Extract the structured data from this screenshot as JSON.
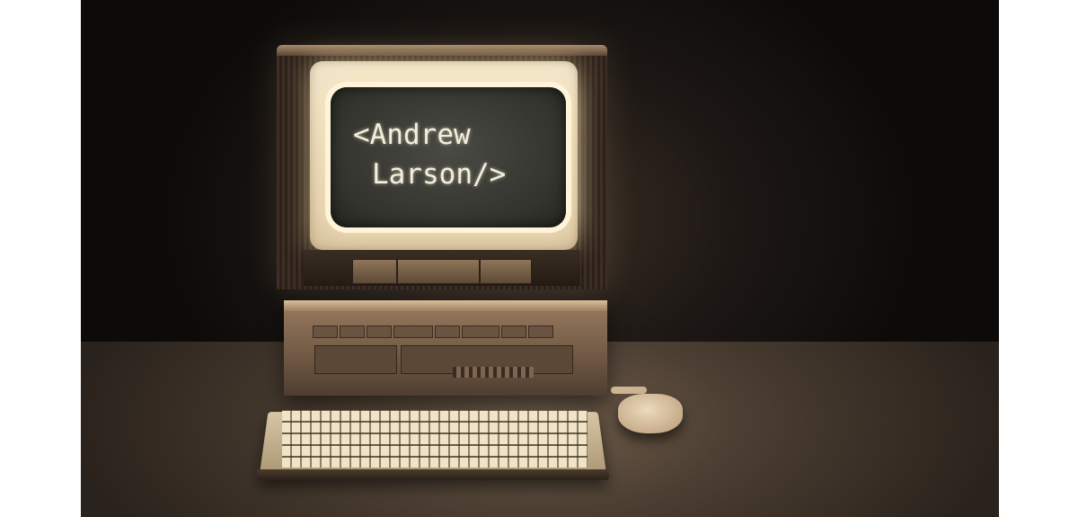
{
  "image": {
    "screen_text": {
      "line1": "<Andrew",
      "line2": "Larson/>"
    },
    "colors": {
      "background": "#1c1714",
      "screen_text": "#f4efdc",
      "bezel_glow": "#fff4da",
      "desk": "#6e5c4a"
    },
    "objects": [
      "crt-monitor",
      "desktop-case",
      "keyboard",
      "mouse"
    ]
  }
}
